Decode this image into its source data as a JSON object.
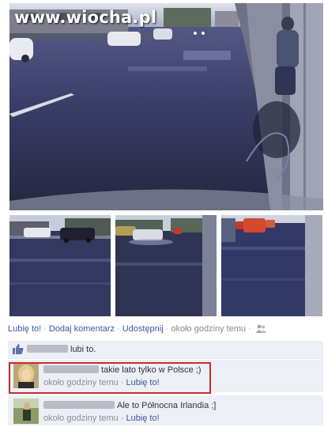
{
  "watermark": "www.wiocha.pl",
  "post": {
    "actions": {
      "like": "Lubię to!",
      "comment": "Dodaj komentarz",
      "share": "Udostępnij",
      "time": "około godziny temu",
      "privacy_icon": "friends-icon"
    },
    "likes": {
      "text": "lubi to.",
      "icon": "thumbs-up-icon"
    }
  },
  "comments": [
    {
      "text": "takie lato tylko w Polsce ;)",
      "time": "około godziny temu",
      "like": "Lubię to!",
      "highlighted": true
    },
    {
      "text": "Ale to Północna Irlandia ;]",
      "time": "około godziny temu",
      "like": "Lubię to!",
      "highlighted": false
    }
  ],
  "colors": {
    "link": "#3b5998",
    "comment_bg": "#eceff5",
    "highlight_border": "#cc2b2b"
  }
}
